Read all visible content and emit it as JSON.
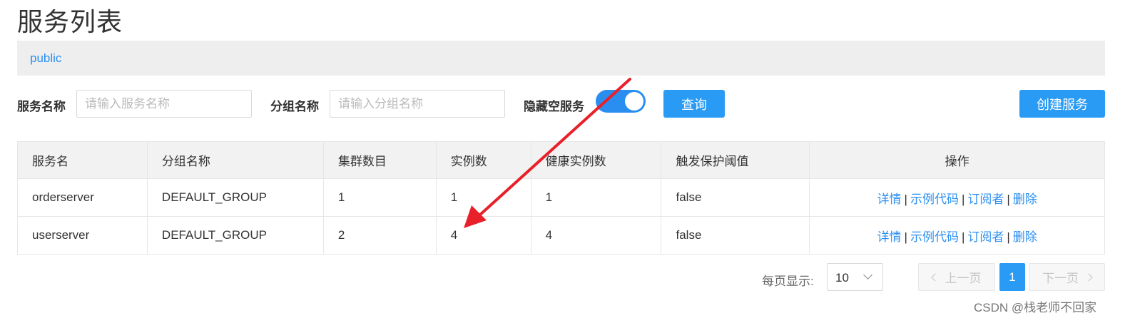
{
  "page": {
    "title": "服务列表"
  },
  "namespace": {
    "name": "public"
  },
  "filters": {
    "service_name_label": "服务名称",
    "service_name_placeholder": "请输入服务名称",
    "group_name_label": "分组名称",
    "group_name_placeholder": "请输入分组名称",
    "hide_empty_label": "隐藏空服务",
    "hide_empty_enabled": true,
    "query_button": "查询",
    "create_button": "创建服务"
  },
  "table": {
    "columns": [
      "服务名",
      "分组名称",
      "集群数目",
      "实例数",
      "健康实例数",
      "触发保护阈值",
      "操作"
    ],
    "rows": [
      {
        "service": "orderserver",
        "group": "DEFAULT_GROUP",
        "clusters": "1",
        "instances": "1",
        "healthy": "1",
        "threshold": "false"
      },
      {
        "service": "userserver",
        "group": "DEFAULT_GROUP",
        "clusters": "2",
        "instances": "4",
        "healthy": "4",
        "threshold": "false"
      }
    ],
    "actions": {
      "detail": "详情",
      "sample_code": "示例代码",
      "subscribers": "订阅者",
      "delete": "删除",
      "separator": "|"
    }
  },
  "pagination": {
    "page_size_label": "每页显示:",
    "page_size": "10",
    "prev": "上一页",
    "current_page": "1",
    "next": "下一页"
  },
  "watermark": "CSDN @栈老师不回家",
  "colors": {
    "accent": "#2a9bf4",
    "link": "#2b8ff0",
    "annotation_arrow": "#e8202a"
  }
}
